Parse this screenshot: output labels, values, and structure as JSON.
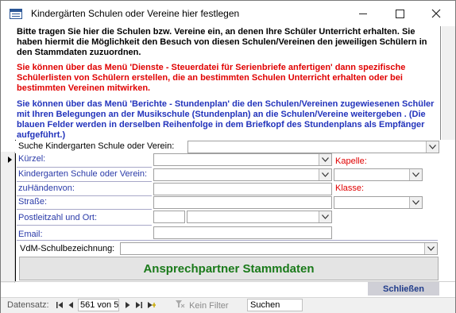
{
  "window": {
    "title": "Kindergärten Schulen oder Vereine hier festlegen",
    "app_icon": "form-icon"
  },
  "info": {
    "paragraph1": "Bitte tragen Sie hier die Schulen bzw. Vereine ein, an denen Ihre Schüler Unterricht erhalten. Sie haben hiermit die Möglichkeit den Besuch von diesen Schulen/Vereinen den jeweiligen Schülern in den Stammdaten zuzuordnen.",
    "paragraph2": "Sie können über das Menü 'Dienste - Steuerdatei für Serienbriefe anfertigen' dann spezifische Schülerlisten von Schülern erstellen, die an bestimmten Schulen Unterricht erhalten oder bei bestimmten Vereinen mitwirken.",
    "paragraph3": "Sie können über das Menü 'Berichte - Stundenplan' die den Schulen/Vereinen zugewiesenen Schüler mit Ihren Belegungen an der Musikschule (Stundenplan) an die Schulen/Vereine weitergeben  . (Die blauen Felder werden in derselben Reihenfolge in dem Briefkopf des Stundenplans als Empfänger aufgeführt.)"
  },
  "search": {
    "label": "Suche Kindergarten Schule oder Verein:",
    "value": ""
  },
  "fields": {
    "kuerzel_label": "Kürzel:",
    "kapelle_label": "Kapelle:",
    "schule_label": "Kindergarten Schule oder Verein:",
    "zuhaenden_label": "zuHändenvon:",
    "klasse_label": "Klasse:",
    "strasse_label": "Straße:",
    "plz_label": "Postleitzahl und Ort:",
    "email_label": "Email:",
    "vdm_label": "VdM-Schulbezeichnung:"
  },
  "buttons": {
    "contacts": "Ansprechpartner Stammdaten",
    "close": "Schließen"
  },
  "navigation": {
    "label": "Datensatz:",
    "position": "561 von 5",
    "no_filter": "Kein Filter",
    "search_placeholder": "Suchen"
  },
  "colors": {
    "blue_label": "#2a3aa8",
    "red_text": "#e00000",
    "green_button_text": "#1a7a1a"
  }
}
